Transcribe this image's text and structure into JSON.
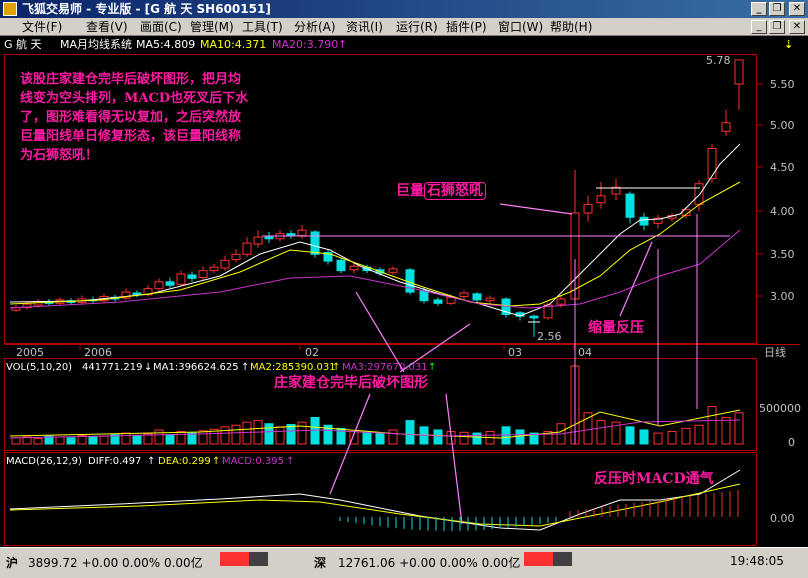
{
  "window": {
    "title": "飞狐交易师 - 专业版 - [G 航 天  SH600151]",
    "min": "_",
    "restore": "❐",
    "close": "✕",
    "doc_min": "_",
    "doc_restore": "❐",
    "doc_close": "✕"
  },
  "menu": [
    "文件(F)",
    "查看(V)",
    "画面(C)",
    "管理(M)",
    "工具(T)",
    "分析(A)",
    "资讯(I)",
    "运行(R)",
    "插件(P)",
    "窗口(W)",
    "帮助(H)"
  ],
  "toolbar": {
    "stock": "G  航  天",
    "indicator": "MA月均线系统",
    "ma5": "MA5:4.809",
    "ma10": "MA10:4.371",
    "ma20": "MA20:3.790",
    "arrow": "↑",
    "pin": "⇣"
  },
  "price_axis": [
    "5.50",
    "5.00",
    "4.50",
    "4.00",
    "3.50",
    "3.00"
  ],
  "high_label": "5.78",
  "low_label": "2.56",
  "time_axis": {
    "years": [
      "2005",
      "2006"
    ],
    "months": [
      "02",
      "03",
      "04"
    ],
    "period": "日线"
  },
  "vol": {
    "header": "VOL(5,10,20)",
    "v": "441771.219",
    "v_arrow": "↓",
    "ma1": "MA1:396624.625",
    "ma1_arrow": "↑",
    "ma2": "MA2:285390.031",
    "ma2_arrow": "↑",
    "ma3": "MA3:297670.031",
    "ma3_arrow": "↑",
    "axis": [
      "500000",
      "0"
    ]
  },
  "macd": {
    "header": "MACD(26,12,9)",
    "diff": "DIFF:0.497",
    "diff_arrow": "↑",
    "dea": "DEA:0.299",
    "dea_arrow": "↑",
    "macd": "MACD:0.395",
    "macd_arrow": "↑",
    "axis": "0.00"
  },
  "annotations": {
    "main": [
      "该股庄家建仓完毕后破坏图形，把月均",
      "线变为空头排列，MACD也死叉后下水",
      "了，图形难看得无以复加，之后突然放",
      "巨量阳线单日修复形态，该巨量阳线称",
      "为石狮怒吼！"
    ],
    "huge_vol_prefix": "巨量",
    "huge_vol_box": "石狮怒吼",
    "shrink": "缩量反压",
    "destroy": "庄家建仓完毕后破坏图形",
    "macd_note": "反压时MACD通气"
  },
  "status": {
    "sh_label": "沪",
    "sh_value": "3899.72 +0.00 0.00% 0.00亿",
    "sz_label": "深",
    "sz_value": "12761.06 +0.00 0.00% 0.00亿",
    "time": "19:48:05"
  },
  "colors": {
    "up": "#ff3030",
    "down": "#00e0e0",
    "annotation": "#ff1aa3",
    "ma5": "#ffffff",
    "ma10": "#ffff00",
    "ma20": "#cc33cc"
  }
}
